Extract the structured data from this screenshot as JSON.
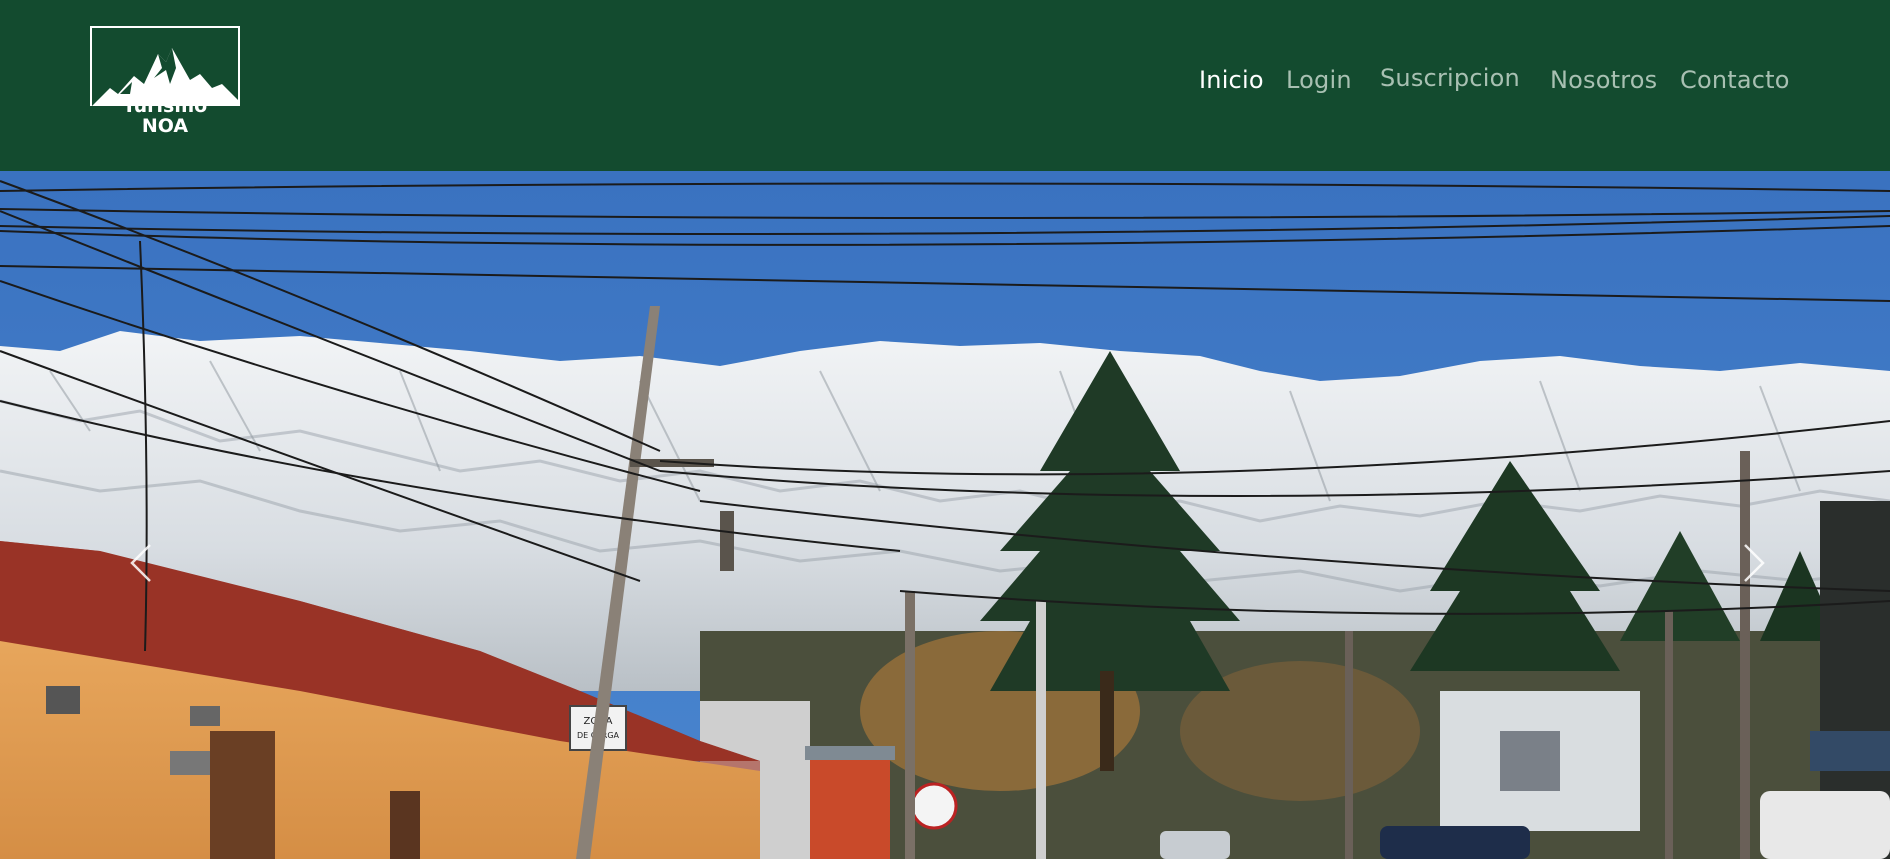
{
  "brand": {
    "logo_line1": "Turismo",
    "logo_line2": "NOA"
  },
  "nav": {
    "items": [
      {
        "label": "Inicio",
        "active": true
      },
      {
        "label": "Login",
        "active": false
      },
      {
        "label": "Suscripcion",
        "active": false
      },
      {
        "label": "Nosotros",
        "active": false
      },
      {
        "label": "Contacto",
        "active": false
      }
    ]
  },
  "hero": {
    "sign_text_1": "ZONA",
    "sign_text_2": "DE CARGA"
  },
  "carousel": {
    "prev_icon": "chevron-left-icon",
    "next_icon": "chevron-right-icon"
  },
  "colors": {
    "navbar_bg": "#134b2f",
    "nav_active": "#ffffff",
    "nav_inactive": "#a8c0b2",
    "sky": "#3d75c2"
  }
}
